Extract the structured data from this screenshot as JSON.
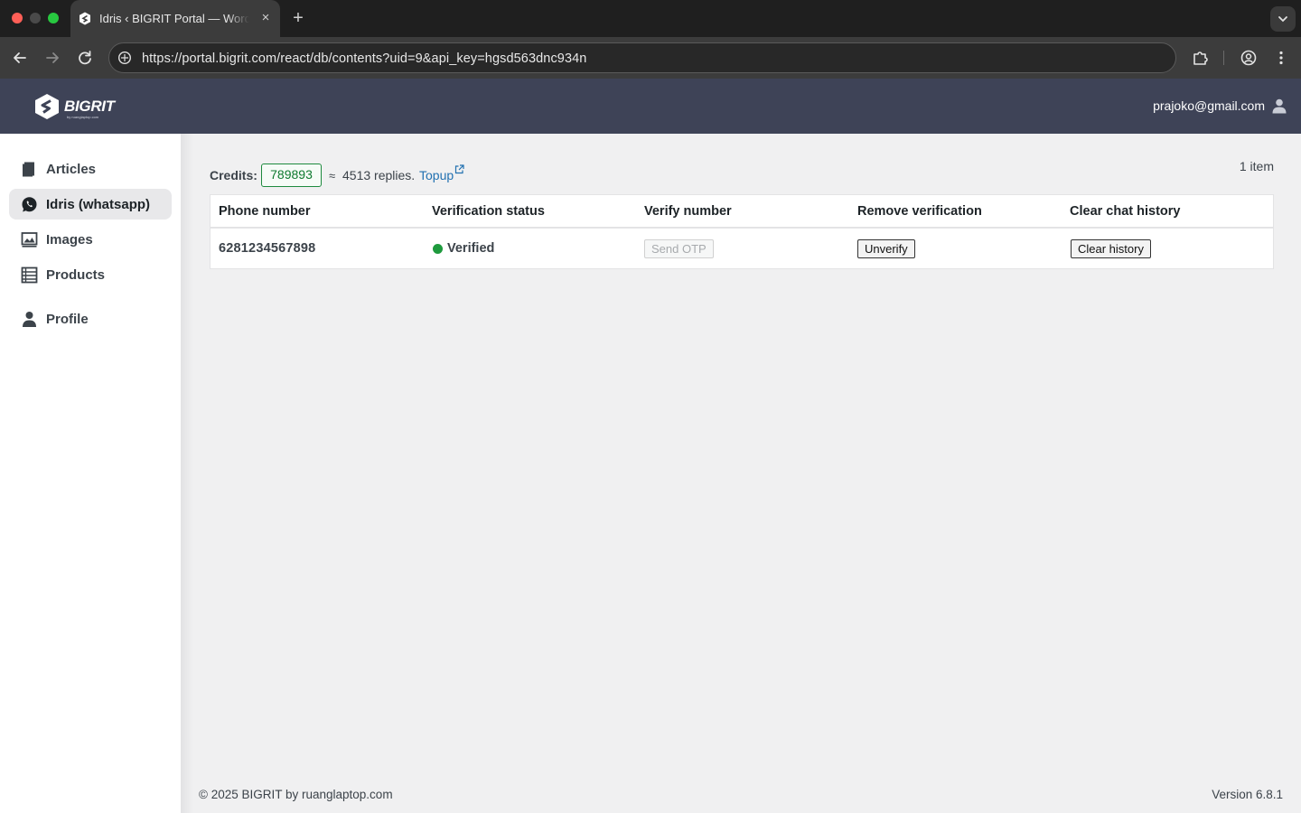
{
  "browser": {
    "tab_title": "Idris ‹ BIGRIT Portal — WordPress",
    "tab_close": "×",
    "new_tab": "+",
    "address": "https://portal.bigrit.com/react/db/contents?uid=9&api_key=hgsd563dnc934n"
  },
  "header": {
    "logo_text": "BIGRIT",
    "logo_subtext": "by ruanglaptop.com",
    "user_email": "prajoko@gmail.com"
  },
  "sidebar": {
    "items": [
      {
        "label": "Articles",
        "icon": "book-icon",
        "active": false
      },
      {
        "label": "Idris (whatsapp)",
        "icon": "whatsapp-icon",
        "active": true
      },
      {
        "label": "Images",
        "icon": "image-icon",
        "active": false
      },
      {
        "label": "Products",
        "icon": "list-icon",
        "active": false
      },
      {
        "label": "Profile",
        "icon": "user-icon",
        "active": false
      }
    ]
  },
  "credits": {
    "label": "Credits:",
    "value": "789893",
    "approx": "≈",
    "replies": "4513 replies.",
    "topup_label": "Topup"
  },
  "table": {
    "item_count": "1 item",
    "columns": [
      "Phone number",
      "Verification status",
      "Verify number",
      "Remove verification",
      "Clear chat history"
    ],
    "rows": [
      {
        "phone": "6281234567898",
        "status": "Verified",
        "status_color": "#1e9a3d",
        "send_otp_label": "Send OTP",
        "unverify_label": "Unverify",
        "clear_history_label": "Clear history"
      }
    ]
  },
  "footer": {
    "copyright": "© 2025 BIGRIT by ruanglaptop.com",
    "version": "Version 6.8.1"
  },
  "colors": {
    "header_bg": "#3e4357",
    "credits_green": "#1e8a3e",
    "link_blue": "#2271b1"
  }
}
